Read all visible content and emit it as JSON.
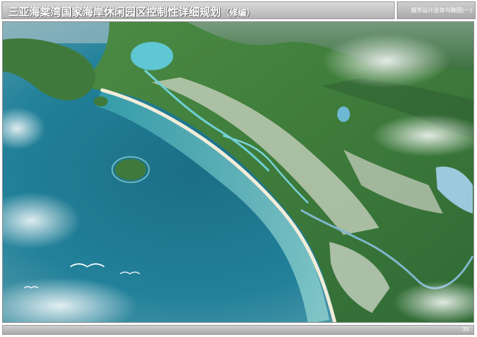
{
  "header": {
    "title": "三亚海棠湾国家海岸休闲园区控制性详细规划",
    "subtitle": "（修编）",
    "section": "城市设计总体鸟瞰图(一)"
  },
  "figure": {
    "icon": "aerial-rendering-image"
  },
  "footer": {
    "page_number": "35"
  },
  "colors": {
    "header_bar": "#c4c4c4",
    "sea_deep": "#1b6f86",
    "sea_shallow": "#5fc3c7",
    "land": "#3e7b3b",
    "beach": "#f2ecd8"
  }
}
